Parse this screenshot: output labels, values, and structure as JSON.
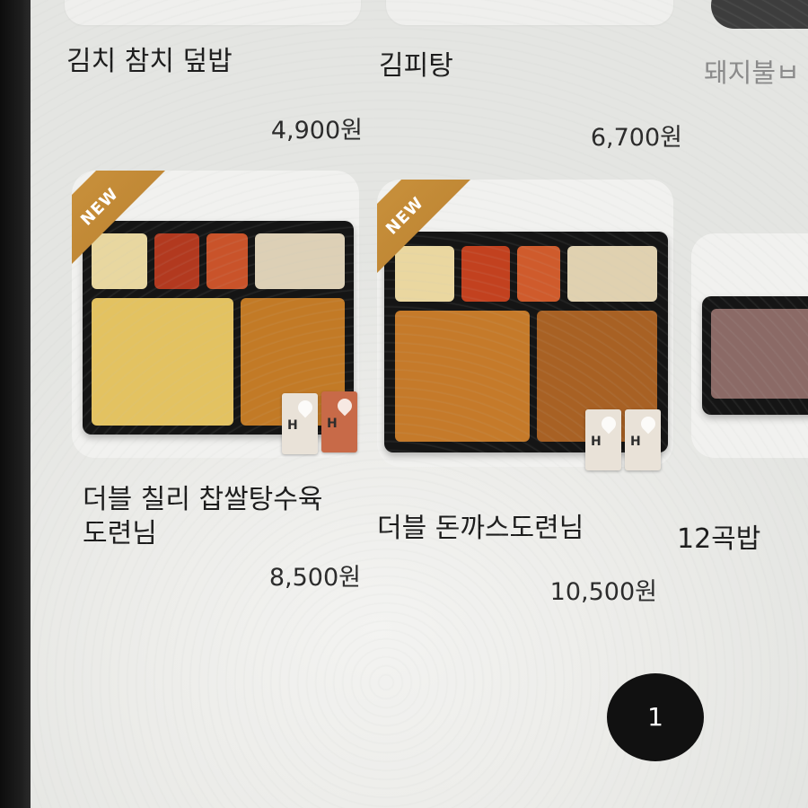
{
  "menu": {
    "items": [
      {
        "name": "김치 참치 덮밥",
        "price": "4,900원",
        "badge": ""
      },
      {
        "name": "김피탕",
        "price": "6,700원",
        "badge": ""
      },
      {
        "name": "돼지불ㅂ",
        "price": "",
        "badge": ""
      },
      {
        "name": "더블 칠리 찹쌀탕수육\n도련님",
        "price": "8,500원",
        "badge": "NEW"
      },
      {
        "name": "더블 돈까스도련님",
        "price": "10,500원",
        "badge": "NEW"
      },
      {
        "name": "12곡밥",
        "price": "",
        "badge": ""
      }
    ]
  },
  "pagination": {
    "current_page": "1"
  },
  "colors": {
    "badge": "#c9913c",
    "page_button": "#111111",
    "background": "#ecece9"
  }
}
